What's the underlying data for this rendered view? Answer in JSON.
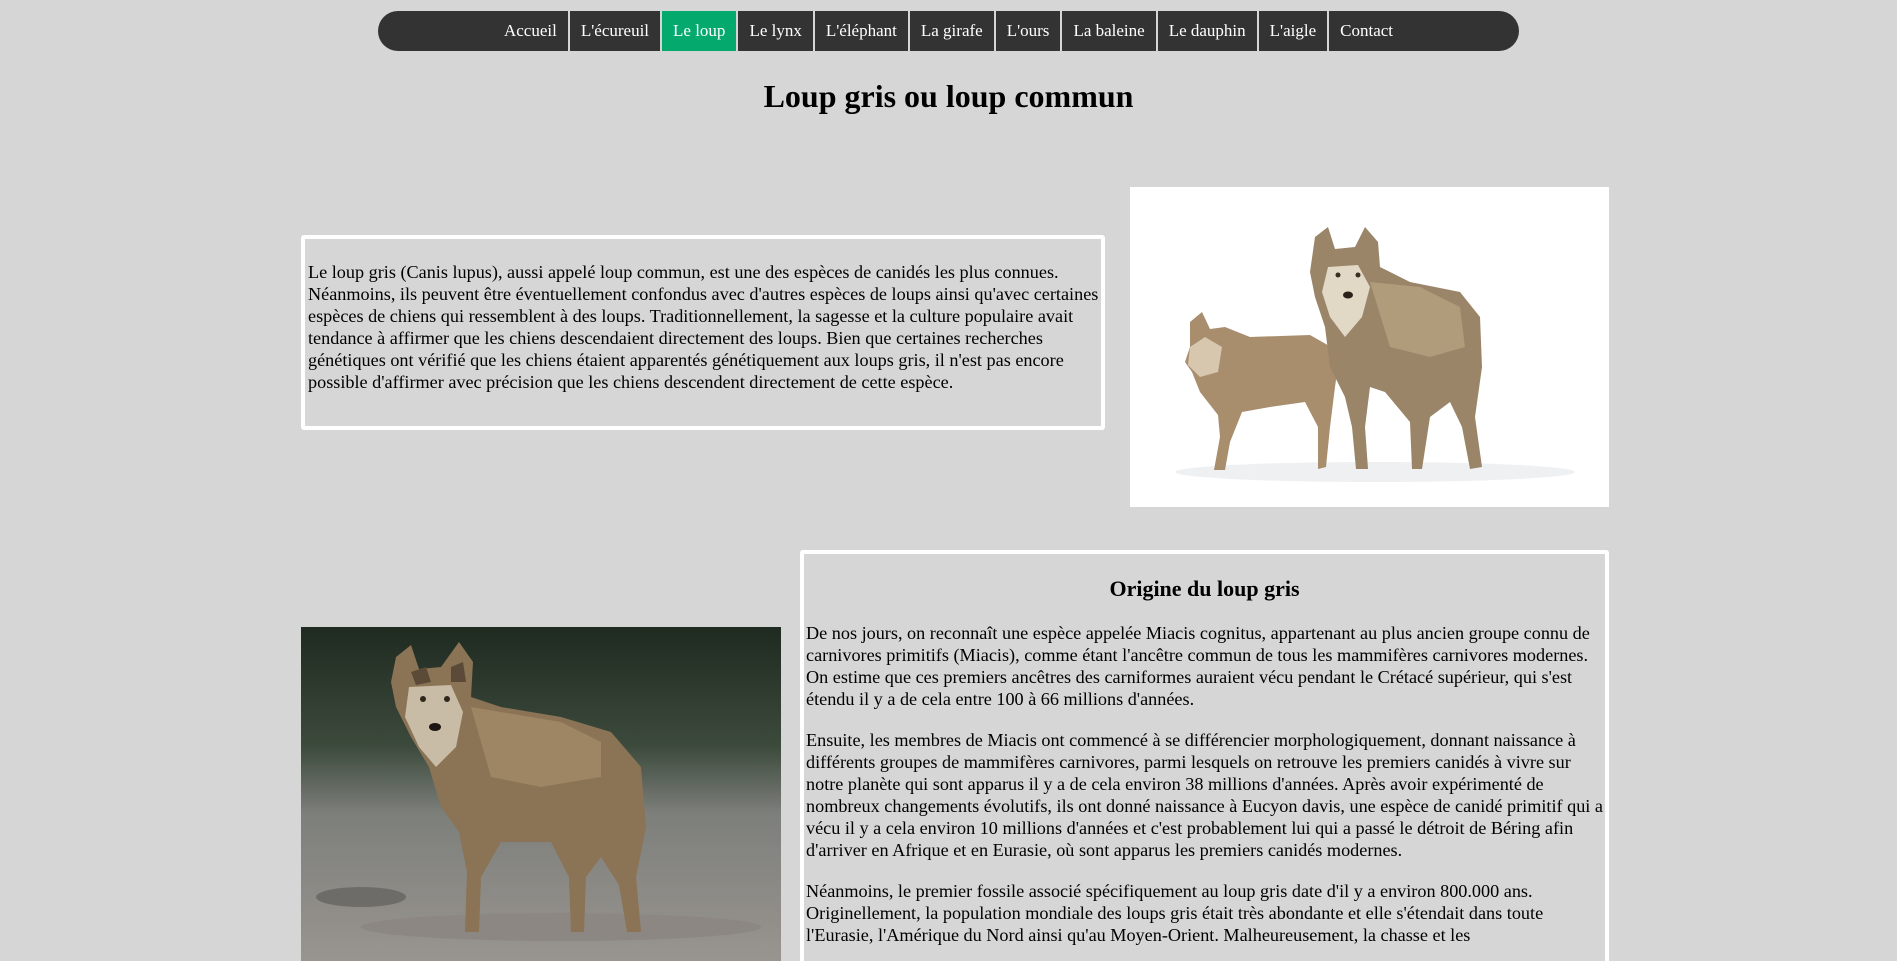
{
  "nav": {
    "items": [
      {
        "label": "Accueil",
        "active": false
      },
      {
        "label": "L'écureuil",
        "active": false
      },
      {
        "label": "Le loup",
        "active": true
      },
      {
        "label": "Le lynx",
        "active": false
      },
      {
        "label": "L'éléphant",
        "active": false
      },
      {
        "label": "La girafe",
        "active": false
      },
      {
        "label": "L'ours",
        "active": false
      },
      {
        "label": "La baleine",
        "active": false
      },
      {
        "label": "Le dauphin",
        "active": false
      },
      {
        "label": "L'aigle",
        "active": false
      },
      {
        "label": "Contact",
        "active": false
      }
    ]
  },
  "page": {
    "title": "Loup gris ou loup commun"
  },
  "intro": {
    "text": "Le loup gris (Canis lupus), aussi appelé loup commun, est une des espèces de canidés les plus connues. Néanmoins, ils peuvent être éventuellement confondus avec d'autres espèces de loups ainsi qu'avec certaines espèces de chiens qui ressemblent à des loups. Traditionnellement, la sagesse et la culture populaire avait tendance à affirmer que les chiens descendaient directement des loups. Bien que certaines recherches génétiques ont vérifié que les chiens étaient apparentés génétiquement aux loups gris, il n'est pas encore possible d'affirmer avec précision que les chiens descendent directement de cette espèce."
  },
  "origin": {
    "title": "Origine du loup gris",
    "paragraphs": [
      "De nos jours, on reconnaît une espèce appelée Miacis cognitus, appartenant au plus ancien groupe connu de carnivores primitifs (Miacis), comme étant l'ancêtre commun de tous les mammifères carnivores modernes. On estime que ces premiers ancêtres des carniformes auraient vécu pendant le Crétacé supérieur, qui s'est étendu il y a de cela entre 100 à 66 millions d'années.",
      "Ensuite, les membres de Miacis ont commencé à se différencier morphologiquement, donnant naissance à différents groupes de mammifères carnivores, parmi lesquels on retrouve les premiers canidés à vivre sur notre planète qui sont apparus il y a de cela environ 38 millions d'années. Après avoir expérimenté de nombreux changements évolutifs, ils ont donné naissance à Eucyon davis, une espèce de canidé primitif qui a vécu il y a cela environ 10 millions d'années et c'est probablement lui qui a passé le détroit de Béring afin d'arriver en Afrique et en Eurasie, où sont apparus les premiers canidés modernes.",
      "Néanmoins, le premier fossile associé spécifiquement au loup gris date d'il y a environ 800.000 ans. Originellement, la population mondiale des loups gris était très abondante et elle s'étendait dans toute l'Eurasie, l'Amérique du Nord ainsi qu'au Moyen-Orient. Malheureusement, la chasse et les"
    ]
  },
  "colors": {
    "background": "#d6d6d6",
    "nav_bg": "#333333",
    "nav_active": "#04aa6d",
    "box_border": "#ffffff"
  }
}
